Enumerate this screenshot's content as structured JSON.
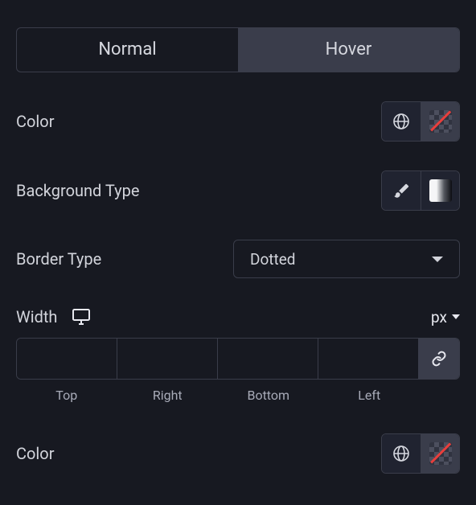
{
  "tabs": {
    "normal": "Normal",
    "hover": "Hover",
    "active": "hover"
  },
  "fields": {
    "color": "Color",
    "bgType": "Background Type",
    "borderType": "Border Type",
    "borderTypeValue": "Dotted",
    "width": "Width",
    "unit": "px",
    "sides": {
      "top": "Top",
      "right": "Right",
      "bottom": "Bottom",
      "left": "Left"
    },
    "values": {
      "top": "",
      "right": "",
      "bottom": "",
      "left": ""
    },
    "color2": "Color"
  }
}
